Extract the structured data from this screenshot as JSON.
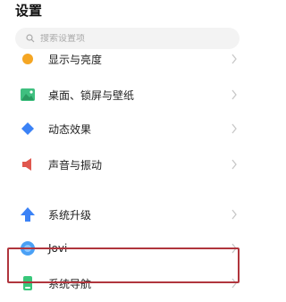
{
  "header": {
    "title": "设置"
  },
  "search": {
    "placeholder": "搜索设置项"
  },
  "items": [
    {
      "label": "显示与亮度",
      "icon": "brightness-icon",
      "color": "#f5a623"
    },
    {
      "label": "桌面、锁屏与壁纸",
      "icon": "wallpaper-icon",
      "color": "#3fbf7f"
    },
    {
      "label": "动态效果",
      "icon": "animation-icon",
      "color": "#3b82f6"
    },
    {
      "label": "声音与振动",
      "icon": "sound-icon",
      "color": "#e0574e"
    },
    {
      "label": "系统升级",
      "icon": "upgrade-icon",
      "color": "#3b82f6"
    },
    {
      "label": "Jovi",
      "icon": "jovi-icon",
      "color": "#4aa0f5"
    },
    {
      "label": "系统导航",
      "icon": "navigation-icon",
      "color": "#38c77a"
    }
  ],
  "highlight_color": "#b0353d"
}
